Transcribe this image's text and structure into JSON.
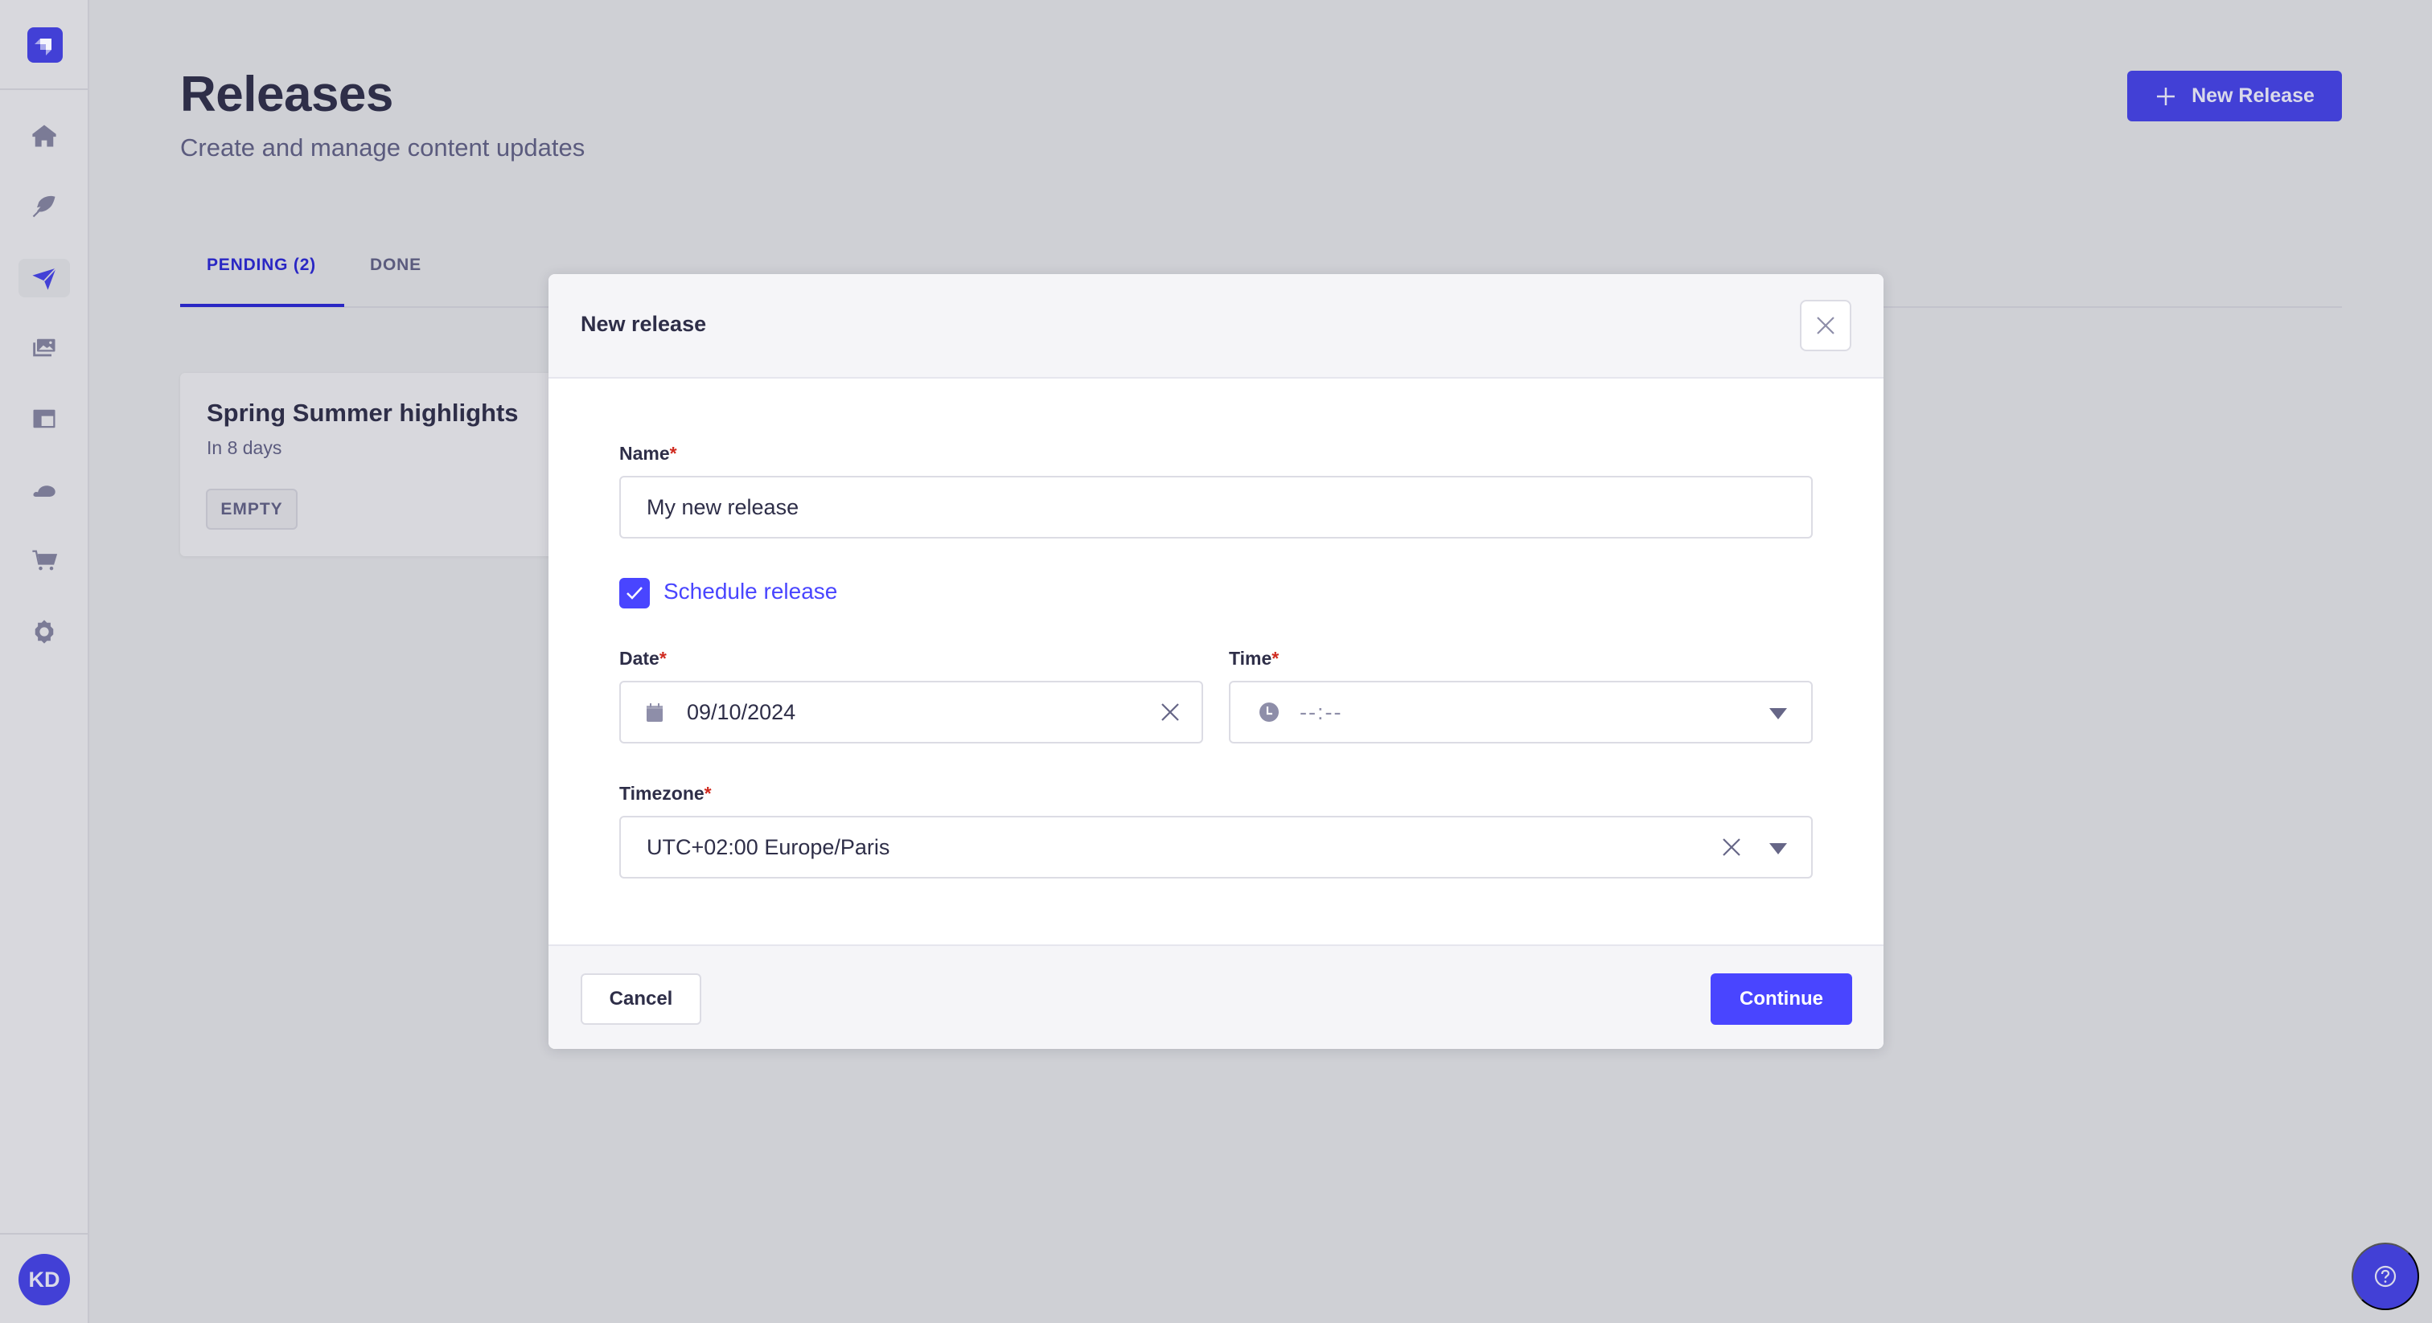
{
  "sidebar": {
    "logo": "strapi-logo-icon",
    "items": [
      {
        "name": "home",
        "icon": "home-icon",
        "active": false
      },
      {
        "name": "content-manager",
        "icon": "feather-icon",
        "active": false
      },
      {
        "name": "releases",
        "icon": "paper-plane-icon",
        "active": true
      },
      {
        "name": "media-library",
        "icon": "images-icon",
        "active": false
      },
      {
        "name": "content-type-builder",
        "icon": "layout-icon",
        "active": false
      },
      {
        "name": "cloud",
        "icon": "cloud-icon",
        "active": false
      },
      {
        "name": "marketplace",
        "icon": "cart-icon",
        "active": false
      },
      {
        "name": "settings",
        "icon": "gear-icon",
        "active": false
      }
    ],
    "avatar_initials": "KD"
  },
  "header": {
    "title": "Releases",
    "subtitle": "Create and manage content updates",
    "new_release_label": "New Release"
  },
  "tabs": [
    {
      "label": "PENDING (2)",
      "active": true
    },
    {
      "label": "DONE",
      "active": false
    }
  ],
  "releases": [
    {
      "title": "Spring Summer highlights",
      "when": "In 8 days",
      "badge": "EMPTY"
    }
  ],
  "modal": {
    "title": "New release",
    "name_label": "Name",
    "name_value": "My new release",
    "schedule_label": "Schedule release",
    "schedule_checked": true,
    "date_label": "Date",
    "date_value": "09/10/2024",
    "time_label": "Time",
    "time_placeholder": "--:--",
    "timezone_label": "Timezone",
    "timezone_value": "UTC+02:00 Europe/Paris",
    "required_marker": "*",
    "cancel_label": "Cancel",
    "continue_label": "Continue"
  },
  "colors": {
    "primary": "#4945FF",
    "primary_dim": "#4240D6",
    "required": "#D02B20",
    "text": "#32324D"
  }
}
